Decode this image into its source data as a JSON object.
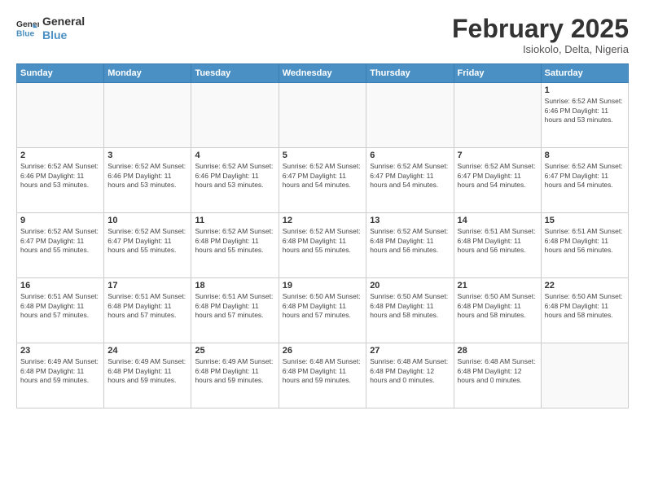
{
  "logo": {
    "line1": "General",
    "line2": "Blue"
  },
  "title": "February 2025",
  "location": "Isiokolo, Delta, Nigeria",
  "weekdays": [
    "Sunday",
    "Monday",
    "Tuesday",
    "Wednesday",
    "Thursday",
    "Friday",
    "Saturday"
  ],
  "weeks": [
    [
      {
        "day": "",
        "info": ""
      },
      {
        "day": "",
        "info": ""
      },
      {
        "day": "",
        "info": ""
      },
      {
        "day": "",
        "info": ""
      },
      {
        "day": "",
        "info": ""
      },
      {
        "day": "",
        "info": ""
      },
      {
        "day": "1",
        "info": "Sunrise: 6:52 AM\nSunset: 6:46 PM\nDaylight: 11 hours and 53 minutes."
      }
    ],
    [
      {
        "day": "2",
        "info": "Sunrise: 6:52 AM\nSunset: 6:46 PM\nDaylight: 11 hours and 53 minutes."
      },
      {
        "day": "3",
        "info": "Sunrise: 6:52 AM\nSunset: 6:46 PM\nDaylight: 11 hours and 53 minutes."
      },
      {
        "day": "4",
        "info": "Sunrise: 6:52 AM\nSunset: 6:46 PM\nDaylight: 11 hours and 53 minutes."
      },
      {
        "day": "5",
        "info": "Sunrise: 6:52 AM\nSunset: 6:47 PM\nDaylight: 11 hours and 54 minutes."
      },
      {
        "day": "6",
        "info": "Sunrise: 6:52 AM\nSunset: 6:47 PM\nDaylight: 11 hours and 54 minutes."
      },
      {
        "day": "7",
        "info": "Sunrise: 6:52 AM\nSunset: 6:47 PM\nDaylight: 11 hours and 54 minutes."
      },
      {
        "day": "8",
        "info": "Sunrise: 6:52 AM\nSunset: 6:47 PM\nDaylight: 11 hours and 54 minutes."
      }
    ],
    [
      {
        "day": "9",
        "info": "Sunrise: 6:52 AM\nSunset: 6:47 PM\nDaylight: 11 hours and 55 minutes."
      },
      {
        "day": "10",
        "info": "Sunrise: 6:52 AM\nSunset: 6:47 PM\nDaylight: 11 hours and 55 minutes."
      },
      {
        "day": "11",
        "info": "Sunrise: 6:52 AM\nSunset: 6:48 PM\nDaylight: 11 hours and 55 minutes."
      },
      {
        "day": "12",
        "info": "Sunrise: 6:52 AM\nSunset: 6:48 PM\nDaylight: 11 hours and 55 minutes."
      },
      {
        "day": "13",
        "info": "Sunrise: 6:52 AM\nSunset: 6:48 PM\nDaylight: 11 hours and 56 minutes."
      },
      {
        "day": "14",
        "info": "Sunrise: 6:51 AM\nSunset: 6:48 PM\nDaylight: 11 hours and 56 minutes."
      },
      {
        "day": "15",
        "info": "Sunrise: 6:51 AM\nSunset: 6:48 PM\nDaylight: 11 hours and 56 minutes."
      }
    ],
    [
      {
        "day": "16",
        "info": "Sunrise: 6:51 AM\nSunset: 6:48 PM\nDaylight: 11 hours and 57 minutes."
      },
      {
        "day": "17",
        "info": "Sunrise: 6:51 AM\nSunset: 6:48 PM\nDaylight: 11 hours and 57 minutes."
      },
      {
        "day": "18",
        "info": "Sunrise: 6:51 AM\nSunset: 6:48 PM\nDaylight: 11 hours and 57 minutes."
      },
      {
        "day": "19",
        "info": "Sunrise: 6:50 AM\nSunset: 6:48 PM\nDaylight: 11 hours and 57 minutes."
      },
      {
        "day": "20",
        "info": "Sunrise: 6:50 AM\nSunset: 6:48 PM\nDaylight: 11 hours and 58 minutes."
      },
      {
        "day": "21",
        "info": "Sunrise: 6:50 AM\nSunset: 6:48 PM\nDaylight: 11 hours and 58 minutes."
      },
      {
        "day": "22",
        "info": "Sunrise: 6:50 AM\nSunset: 6:48 PM\nDaylight: 11 hours and 58 minutes."
      }
    ],
    [
      {
        "day": "23",
        "info": "Sunrise: 6:49 AM\nSunset: 6:48 PM\nDaylight: 11 hours and 59 minutes."
      },
      {
        "day": "24",
        "info": "Sunrise: 6:49 AM\nSunset: 6:48 PM\nDaylight: 11 hours and 59 minutes."
      },
      {
        "day": "25",
        "info": "Sunrise: 6:49 AM\nSunset: 6:48 PM\nDaylight: 11 hours and 59 minutes."
      },
      {
        "day": "26",
        "info": "Sunrise: 6:48 AM\nSunset: 6:48 PM\nDaylight: 11 hours and 59 minutes."
      },
      {
        "day": "27",
        "info": "Sunrise: 6:48 AM\nSunset: 6:48 PM\nDaylight: 12 hours and 0 minutes."
      },
      {
        "day": "28",
        "info": "Sunrise: 6:48 AM\nSunset: 6:48 PM\nDaylight: 12 hours and 0 minutes."
      },
      {
        "day": "",
        "info": ""
      }
    ]
  ]
}
